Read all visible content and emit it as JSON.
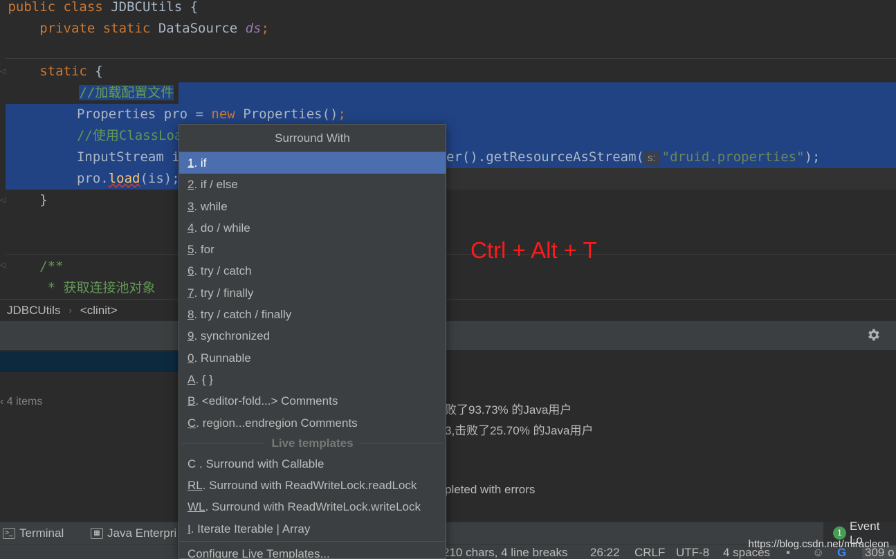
{
  "editor": {
    "line1": {
      "kw": "public class",
      "name": "JDBCUtils",
      "brace": "{"
    },
    "line2": {
      "kw": "private static",
      "type": "DataSource",
      "field": "ds",
      "semi": ";"
    },
    "line3": {
      "kw": "static",
      "brace": "{"
    },
    "line4": {
      "comment": "//加载配置文件"
    },
    "line5": {
      "type": "Properties pro = ",
      "kw": "new",
      "rest": "Properties()",
      "semi": ";"
    },
    "line6": {
      "comment": "//使用ClassLoa"
    },
    "line7": {
      "start": "InputStream i",
      "end_method": "er().getResourceAsStream(",
      "hint": "s:",
      "string": "\"druid.properties\"",
      "end": ");"
    },
    "line8": {
      "obj": "pro.",
      "method": "load",
      "args": "(is);"
    },
    "line9": {
      "brace": "}"
    },
    "line10": {
      "comment": "/**"
    },
    "line11": {
      "comment": " * 获取连接池对象"
    }
  },
  "breadcrumb": {
    "class": "JDBCUtils",
    "method": "<clinit>"
  },
  "tool_panel": {
    "tree_count": "4 items",
    "messages": [
      "败了93.73% 的Java用户",
      "3,击败了25.70% 的Java用户",
      "pleted with errors"
    ]
  },
  "shortcut_label": "Ctrl + Alt + T",
  "popup": {
    "title": "Surround With",
    "items": [
      {
        "mn": "1",
        "label": ". if"
      },
      {
        "mn": "2",
        "label": ". if / else"
      },
      {
        "mn": "3",
        "label": ". while"
      },
      {
        "mn": "4",
        "label": ". do / while"
      },
      {
        "mn": "5",
        "label": ". for"
      },
      {
        "mn": "6",
        "label": ". try / catch"
      },
      {
        "mn": "7",
        "label": ". try / finally"
      },
      {
        "mn": "8",
        "label": ". try / catch / finally"
      },
      {
        "mn": "9",
        "label": ". synchronized"
      },
      {
        "mn": "0",
        "label": ". Runnable"
      },
      {
        "mn": "A",
        "label": ". { }"
      },
      {
        "mn": "B",
        "label": ". <editor-fold...> Comments"
      },
      {
        "mn": "C",
        "label": ". region...endregion Comments"
      }
    ],
    "group_label": "Live templates",
    "templates": [
      {
        "mn": "",
        "label": "C . Surround with Callable"
      },
      {
        "mn": "RL",
        "label": ". Surround with ReadWriteLock.readLock"
      },
      {
        "mn": "WL",
        "label": ". Surround with ReadWriteLock.writeLock"
      },
      {
        "mn": "I",
        "label": ". Iterate Iterable | Array"
      }
    ],
    "footer": "Configure Live Templates..."
  },
  "tool_strip": {
    "terminal": "Terminal",
    "java_enterprise": "Java Enterpri",
    "event_log_count": "1",
    "event_log": "Event Lo"
  },
  "status_bar": {
    "chars": "210 chars, 4 line breaks",
    "position": "26:22",
    "line_sep": "CRLF",
    "encoding": "UTF-8",
    "indent": "4 spaces",
    "memory": "309 o"
  },
  "watermark": "https://blog.csdn.net/miracleon",
  "colors": {
    "selection": "#214283",
    "popup_selected": "#4b6eaf",
    "shortcut": "#ff1a1a"
  }
}
